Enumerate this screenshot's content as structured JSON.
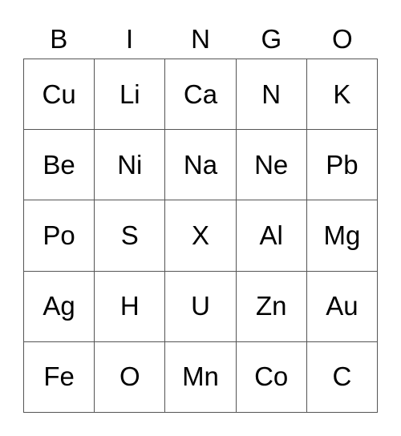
{
  "card": {
    "header": [
      "B",
      "I",
      "N",
      "G",
      "O"
    ],
    "rows": [
      [
        "Cu",
        "Li",
        "Ca",
        "N",
        "K"
      ],
      [
        "Be",
        "Ni",
        "Na",
        "Ne",
        "Pb"
      ],
      [
        "Po",
        "S",
        "X",
        "Al",
        "Mg"
      ],
      [
        "Ag",
        "H",
        "U",
        "Zn",
        "Au"
      ],
      [
        "Fe",
        "O",
        "Mn",
        "Co",
        "C"
      ]
    ]
  },
  "colors": {
    "background": "#ffffff",
    "text": "#000000",
    "grid_line": "#555555"
  }
}
